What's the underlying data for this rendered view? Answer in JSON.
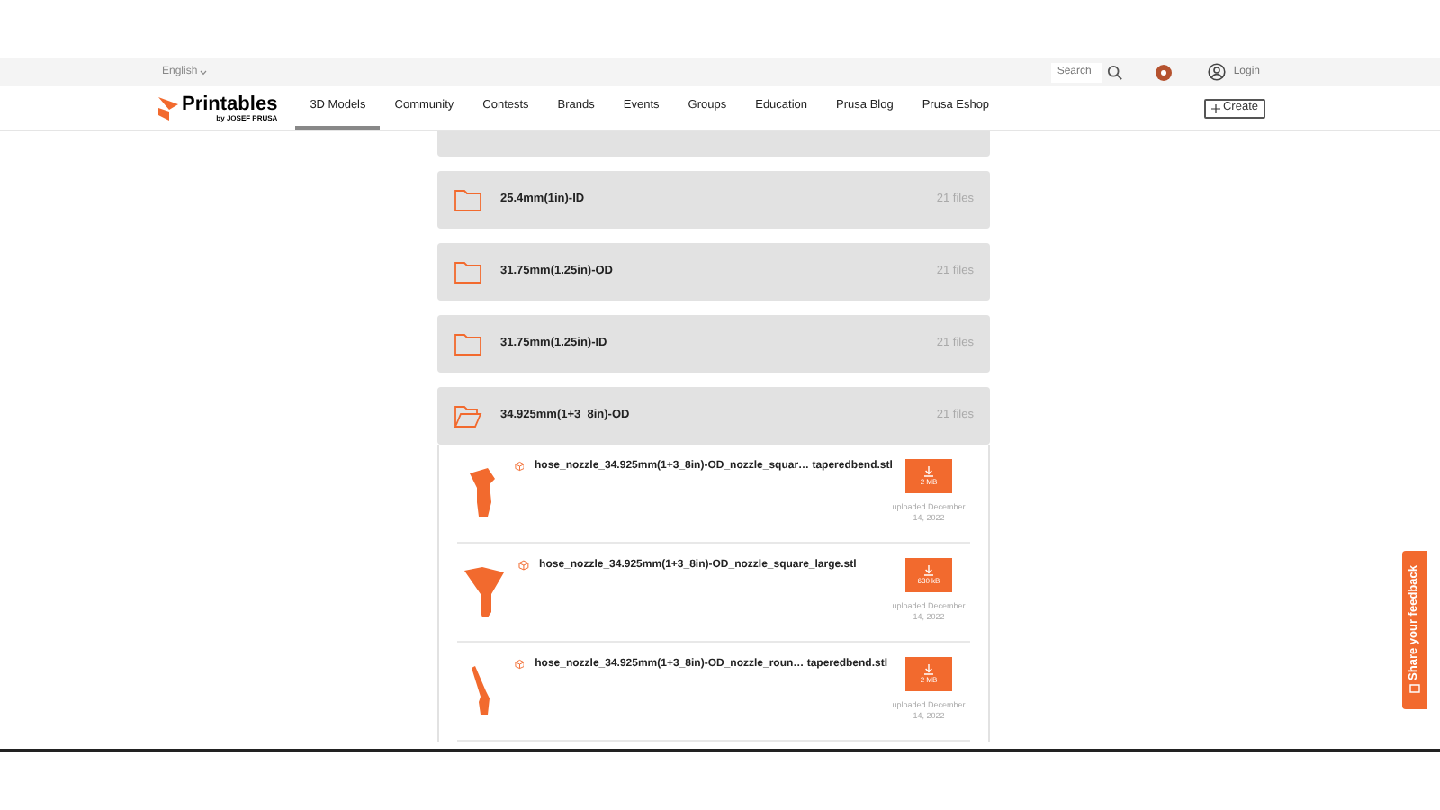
{
  "top_bar": {
    "language": "English",
    "search": {
      "placeholder": "Search"
    },
    "login": "Login"
  },
  "nav": {
    "logo": "Printables",
    "logo_sub": "by JOSEF PRUSA",
    "tabs": [
      {
        "label": "3D Models",
        "selected": true
      },
      {
        "label": "Community",
        "selected": false
      },
      {
        "label": "Contests",
        "selected": false
      },
      {
        "label": "Brands",
        "selected": false
      },
      {
        "label": "Events",
        "selected": false
      },
      {
        "label": "Groups",
        "selected": false
      },
      {
        "label": "Education",
        "selected": false
      },
      {
        "label": "Prusa Blog",
        "selected": false
      },
      {
        "label": "Prusa Eshop",
        "selected": false
      }
    ],
    "create": "Create"
  },
  "folders": [
    {
      "name": "25.4mm(1in)-ID",
      "count": "21 files",
      "expanded": false
    },
    {
      "name": "31.75mm(1.25in)-OD",
      "count": "21 files",
      "expanded": false
    },
    {
      "name": "31.75mm(1.25in)-ID",
      "count": "21 files",
      "expanded": false
    },
    {
      "name": "34.925mm(1+3_8in)-OD",
      "count": "21 files",
      "expanded": true,
      "files": [
        {
          "name": "hose_nozzle_34.925mm(1+3_8in)-OD_nozzle_squar… taperedbend.stl",
          "size": "2 MB",
          "uploaded": "uploaded December 14, 2022",
          "kind": "bend"
        },
        {
          "name": "hose_nozzle_34.925mm(1+3_8in)-OD_nozzle_square_large.stl",
          "size": "630 kB",
          "uploaded": "uploaded December 14, 2022",
          "kind": "funnel"
        },
        {
          "name": "hose_nozzle_34.925mm(1+3_8in)-OD_nozzle_roun… taperedbend.stl",
          "size": "2 MB",
          "uploaded": "uploaded December 14, 2022",
          "kind": "thin"
        }
      ]
    }
  ],
  "feedback": "Share your feedback"
}
